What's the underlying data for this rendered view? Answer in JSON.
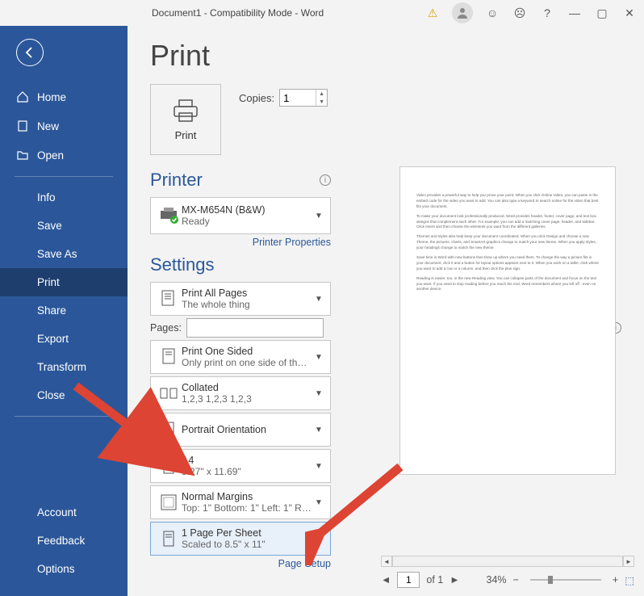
{
  "titlebar": {
    "title": "Document1  -  Compatibility Mode  -  Word"
  },
  "sidebar": {
    "items": [
      {
        "label": "Home"
      },
      {
        "label": "New"
      },
      {
        "label": "Open"
      },
      {
        "label": "Info"
      },
      {
        "label": "Save"
      },
      {
        "label": "Save As"
      },
      {
        "label": "Print"
      },
      {
        "label": "Share"
      },
      {
        "label": "Export"
      },
      {
        "label": "Transform"
      },
      {
        "label": "Close"
      },
      {
        "label": "Account"
      },
      {
        "label": "Feedback"
      },
      {
        "label": "Options"
      }
    ]
  },
  "page": {
    "title": "Print",
    "print_button": "Print",
    "copies_label": "Copies:",
    "copies_value": "1"
  },
  "printer": {
    "heading": "Printer",
    "name": "MX-M654N (B&W)",
    "status": "Ready",
    "properties_link": "Printer Properties"
  },
  "settings": {
    "heading": "Settings",
    "print_all": {
      "l1": "Print All Pages",
      "l2": "The whole thing"
    },
    "pages_label": "Pages:",
    "pages_value": "",
    "sided": {
      "l1": "Print One Sided",
      "l2": "Only print on one side of th…"
    },
    "collated": {
      "l1": "Collated",
      "l2": "1,2,3    1,2,3    1,2,3"
    },
    "orientation": {
      "l1": "Portrait Orientation"
    },
    "paper": {
      "l1": "A4",
      "l2": "8.27\" x 11.69\""
    },
    "margins": {
      "l1": "Normal Margins",
      "l2": "Top: 1\" Bottom: 1\" Left: 1\" Ri…"
    },
    "scale": {
      "l1": "1 Page Per Sheet",
      "l2": "Scaled to 8.5\" x 11\""
    },
    "page_setup_link": "Page Setup"
  },
  "preview": {
    "page_current": "1",
    "page_total": "of 1",
    "zoom": "34%",
    "body": [
      "Video provides a powerful way to help you prove your point. When you click Online Video, you can paste in the embed code for the video you want to add. You can also type a keyword to search online for the video that best fits your document.",
      "To make your document look professionally produced, Word provides header, footer, cover page, and text box designs that complement each other. For example, you can add a matching cover page, header, and sidebar. Click Insert and then choose the elements you want from the different galleries.",
      "Themes and styles also help keep your document coordinated. When you click Design and choose a new Theme, the pictures, charts, and SmartArt graphics change to match your new theme. When you apply styles, your headings change to match the new theme.",
      "Save time in Word with new buttons that show up where you need them. To change the way a picture fits in your document, click it and a button for layout options appears next to it. When you work on a table, click where you want to add a row or a column, and then click the plus sign.",
      "Reading is easier, too, in the new Reading view. You can collapse parts of the document and focus on the text you want. If you need to stop reading before you reach the end, Word remembers where you left off - even on another device."
    ]
  }
}
